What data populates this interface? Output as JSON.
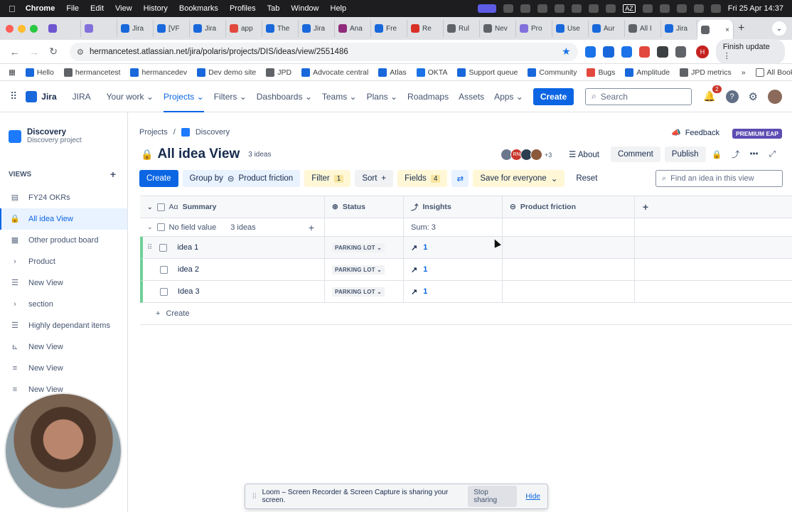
{
  "menubar": {
    "app": "Chrome",
    "items": [
      "File",
      "Edit",
      "View",
      "History",
      "Bookmarks",
      "Profiles",
      "Tab",
      "Window",
      "Help"
    ],
    "datetime": "Fri 25 Apr 14:37",
    "tray_az": "AZ"
  },
  "tabs": [
    {
      "label": "",
      "color": "#6e56cf"
    },
    {
      "label": "",
      "color": "#8270db"
    },
    {
      "label": "Jira",
      "color": "#1868db"
    },
    {
      "label": "[VF",
      "color": "#1868db"
    },
    {
      "label": "Jira",
      "color": "#1868db"
    },
    {
      "label": "app",
      "color": "#e2483d"
    },
    {
      "label": "The",
      "color": "#1868db"
    },
    {
      "label": "Jira",
      "color": "#1868db"
    },
    {
      "label": "Ana",
      "color": "#8f2b7a"
    },
    {
      "label": "Fre",
      "color": "#1868db"
    },
    {
      "label": "Re",
      "color": "#d93025"
    },
    {
      "label": "Rul",
      "color": "#5f6368"
    },
    {
      "label": "Nev",
      "color": "#5f6368"
    },
    {
      "label": "Pro",
      "color": "#8270db"
    },
    {
      "label": "Use",
      "color": "#1868db"
    },
    {
      "label": "Aur",
      "color": "#1868db"
    },
    {
      "label": "All I",
      "color": "#5f6368"
    },
    {
      "label": "Jira",
      "color": "#1868db"
    },
    {
      "label": "",
      "color": "#5f6368"
    }
  ],
  "address": {
    "url": "hermancetest.atlassian.net/jira/polaris/projects/DIS/ideas/view/2551486",
    "profile_initial": "H",
    "finish_update": "Finish update"
  },
  "bookmarks": {
    "items": [
      "Hello",
      "hermancetest",
      "hermancedev",
      "Dev demo site",
      "JPD",
      "Advocate central",
      "Atlas",
      "OKTA",
      "Support queue",
      "Community",
      "Bugs",
      "Amplitude",
      "JPD metrics"
    ],
    "more": "»",
    "all": "All Bookmarks"
  },
  "jira_nav": {
    "product": "Jira",
    "site": "JIRA",
    "items": [
      "Your work",
      "Projects",
      "Filters",
      "Dashboards",
      "Teams",
      "Plans",
      "Roadmaps",
      "Assets",
      "Apps"
    ],
    "create": "Create",
    "search_placeholder": "Search",
    "notif_count": "2"
  },
  "sidebar": {
    "project_name": "Discovery",
    "project_type": "Discovery project",
    "views_label": "VIEWS",
    "items": [
      {
        "label": "FY24 OKRs",
        "icon": "▤"
      },
      {
        "label": "All idea View",
        "icon": "🔒"
      },
      {
        "label": "Other product board",
        "icon": "▦"
      },
      {
        "label": "Product",
        "icon": "›"
      },
      {
        "label": "New View",
        "icon": "☰"
      },
      {
        "label": "section",
        "icon": "›"
      },
      {
        "label": "Highly dependant items",
        "icon": "☰"
      },
      {
        "label": "New View",
        "icon": "⊾"
      },
      {
        "label": "New View",
        "icon": "≡"
      },
      {
        "label": "New View",
        "icon": "≡"
      }
    ]
  },
  "main": {
    "breadcrumb_root": "Projects",
    "breadcrumb_sep": "/",
    "breadcrumb_project": "Discovery",
    "feedback": "Feedback",
    "premium": "PREMIUM EAP",
    "title": "All idea View",
    "idea_count": "3 ideas",
    "avatars_more": "+3",
    "avatar_rn": "RN",
    "about": "About",
    "comment": "Comment",
    "publish": "Publish"
  },
  "toolbar": {
    "create": "Create",
    "group_by": "Group by",
    "group_field": "Product friction",
    "filter": "Filter",
    "filter_count": "1",
    "sort": "Sort",
    "sort_plus": "+",
    "fields": "Fields",
    "fields_count": "4",
    "save": "Save for everyone",
    "reset": "Reset",
    "find_placeholder": "Find an idea in this view"
  },
  "table": {
    "columns": [
      "Summary",
      "Status",
      "Insights",
      "Product friction"
    ],
    "group": {
      "label": "No field value",
      "count": "3 ideas",
      "sum": "Sum: 3"
    },
    "rows": [
      {
        "summary": "idea 1",
        "status": "PARKING LOT",
        "insights": "1"
      },
      {
        "summary": "idea 2",
        "status": "PARKING LOT",
        "insights": "1"
      },
      {
        "summary": "Idea 3",
        "status": "PARKING LOT",
        "insights": "1"
      }
    ],
    "create": "Create"
  },
  "loom": {
    "message": "Loom – Screen Recorder & Screen Capture is sharing your screen.",
    "stop": "Stop sharing",
    "hide": "Hide"
  }
}
